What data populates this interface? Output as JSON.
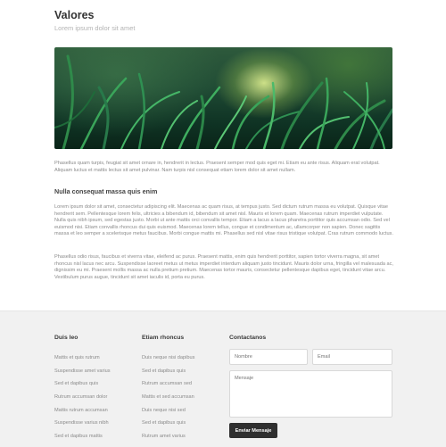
{
  "header": {
    "title": "Valores",
    "subtitle": "Lorem ipsum dolor sit amet"
  },
  "hero": {
    "image": "grass-photo"
  },
  "content": {
    "paragraph1": "Phasellus quam turpis, feugiat sit amet ornare in, hendrerit in lectus. Praesent semper mod quis eget mi. Etiam eu ante risus. Aliquam erat volutpat. Aliquam luctus et mattis lectus sit amet pulvinar. Nam turpis nisl consequat etiam lorem dolor sit amet nullam.",
    "heading": "Nulla consequat massa quis enim",
    "paragraph2": "Lorem ipsum dolor sit amet, consectetur adipiscing elit. Maecenas ac quam risus, at tempus justo. Sed dictum rutrum massa eu volutpat. Quisque vitae hendrerit sem. Pellentesque lorem felis, ultricies a bibendum id, bibendum sit amet nisl. Mauris et lorem quam. Maecenas rutrum imperdiet vulputate. Nulla quis nibh ipsum, sed egestas justo. Morbi ut ante mattis orci convallis tempor. Etiam a lacus a lacus pharetra porttitor quis accumsan odio. Sed vel euismod nisi. Etiam convallis rhoncus dui quis euismod. Maecenas lorem tellus, congue et condimentum ac, ullamcorper non sapien. Donec sagittis massa et leo semper a scelerisque metus faucibus. Morbi congue mattis mi. Phasellus sed nisl vitae risus tristique volutpat. Cras rutrum commodo luctus.",
    "paragraph3": "Phasellus odio risus, faucibus et viverra vitae, eleifend ac purus. Praesent mattis, enim quis hendrerit porttitor, sapien tortor viverra magna, sit amet rhoncus nisl lacus nec arcu. Suspendisse laoreet metus ut metus imperdiet interdum aliquam justo tincidunt. Mauris dolor urna, fringilla vel malesuada ac, dignissim eu mi. Praesent mollis massa ac nulla pretium pretium. Maecenas tortor mauris, consectetur pellentesque dapibus eget, tincidunt vitae arcu. Vestibulum purus augue, tincidunt sit amet iaculis id, porta eu purus."
  },
  "footer": {
    "col1": {
      "title": "Duis leo",
      "links": [
        "Mattis et quis rutrum",
        "Suspendisse amet varius",
        "Sed et dapibus quis",
        "Rutrum accumsan dolor",
        "Mattis rutrum accumsan",
        "Suspendisse varius nibh",
        "Sed et dapibus mattis"
      ]
    },
    "col2": {
      "title": "Etiam rhoncus",
      "links": [
        "Duis neque nisi dapibus",
        "Sed et dapibus quis",
        "Rutrum accumsan sed",
        "Mattis et sed accumsan",
        "Duis neque nisi sed",
        "Sed et dapibus quis",
        "Rutrum amet varius"
      ]
    },
    "contact": {
      "title": "Contactanos",
      "name_placeholder": "Nombre",
      "email_placeholder": "Email",
      "message_placeholder": "Mensaje",
      "submit_label": "Enviar Mensaje"
    }
  }
}
